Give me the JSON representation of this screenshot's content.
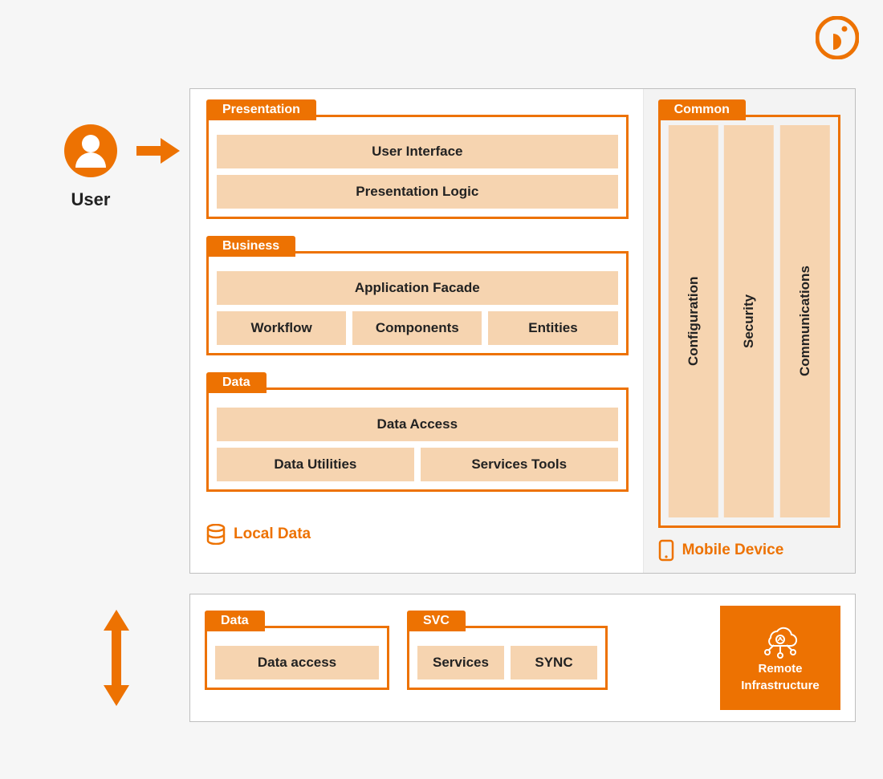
{
  "user": {
    "label": "User"
  },
  "layers": {
    "presentation": {
      "tab": "Presentation",
      "items": [
        "User Interface",
        "Presentation Logic"
      ]
    },
    "business": {
      "tab": "Business",
      "facade": "Application Facade",
      "items": [
        "Workflow",
        "Components",
        "Entities"
      ]
    },
    "data": {
      "tab": "Data",
      "access": "Data Access",
      "items": [
        "Data Utilities",
        "Services Tools"
      ]
    },
    "common": {
      "tab": "Common",
      "items": [
        "Configuration",
        "Security",
        "Communications"
      ]
    }
  },
  "footers": {
    "local": "Local Data",
    "mobile": "Mobile Device"
  },
  "bottom": {
    "data": {
      "tab": "Data",
      "item": "Data access"
    },
    "svc": {
      "tab": "SVC",
      "items": [
        "Services",
        "SYNC"
      ]
    },
    "remote": {
      "line1": "Remote",
      "line2": "Infrastructure"
    }
  }
}
